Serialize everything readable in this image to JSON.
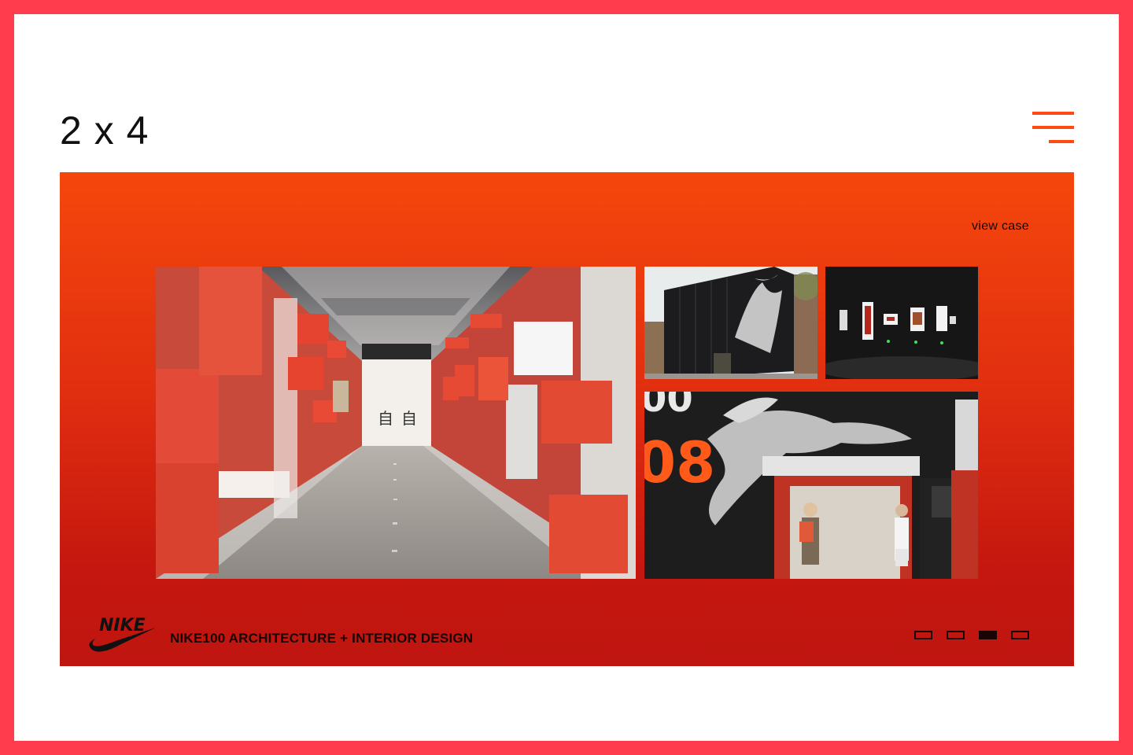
{
  "header": {
    "logo_text": "2 x 4",
    "menu_icon": "hamburger-menu-icon"
  },
  "hero": {
    "view_case_label": "view case",
    "project_title": "NIKE100 ARCHITECTURE + INTERIOR DESIGN",
    "brand_logo_text": "NIKE",
    "photos": [
      {
        "icon": "corridor-photo"
      },
      {
        "icon": "building-facade-photo"
      },
      {
        "icon": "gallery-wall-photo"
      },
      {
        "icon": "athlete-mural-photo"
      }
    ],
    "pagination": {
      "total": 4,
      "active_index": 2
    }
  },
  "colors": {
    "frame": "#ff3b4e",
    "accent": "#ff4a12",
    "hero_top": "#f5470c",
    "hero_bottom": "#bf1510"
  }
}
